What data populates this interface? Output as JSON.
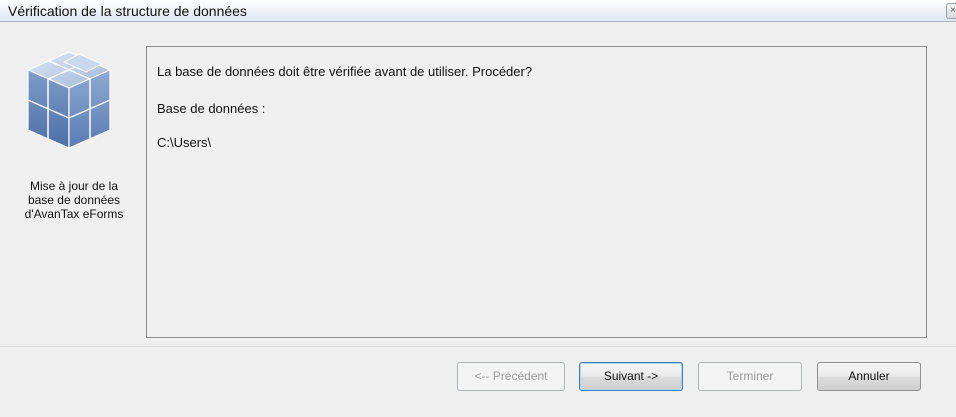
{
  "window": {
    "title": "Vérification de la structure de données"
  },
  "sidebar": {
    "icon": "database-cubes-icon",
    "caption": "Mise à jour de la base de données d'AvanTax eForms"
  },
  "content": {
    "question": "La base de données doit être vérifiée avant de utiliser. Procéder?",
    "db_label": "Base de données :",
    "db_path": "C:\\Users\\"
  },
  "buttons": {
    "previous": "<-- Précédent",
    "next": "Suivant ->",
    "finish": "Terminer",
    "cancel": "Annuler"
  },
  "colors": {
    "window_bg": "#efefef",
    "default_button_border": "#3c7fb1"
  }
}
